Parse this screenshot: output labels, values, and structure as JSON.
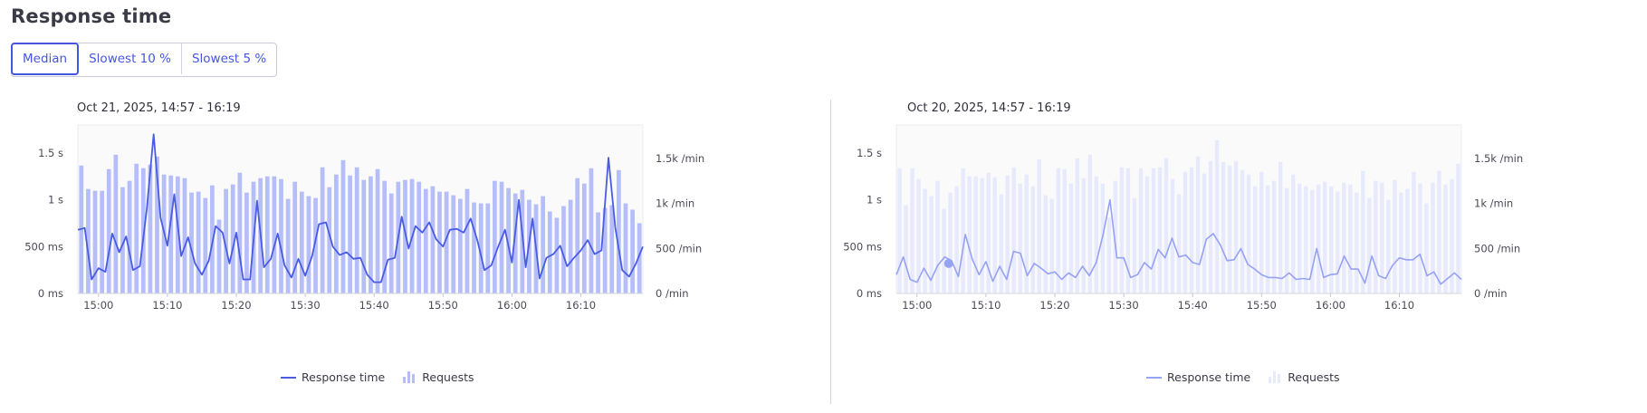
{
  "header": {
    "title": "Response time",
    "tabs": [
      {
        "label": "Median",
        "active": true
      },
      {
        "label": "Slowest 10 %",
        "active": false
      },
      {
        "label": "Slowest 5 %",
        "active": false
      }
    ]
  },
  "colors": {
    "accent": "#4556e0",
    "left_line": "#4a5ce2",
    "left_bars": "#b6befa",
    "right_line": "#96a2f4",
    "right_bars": "#e7e9fd",
    "plot_bg": "#fafafb"
  },
  "legend": {
    "line_label": "Response time",
    "bars_label": "Requests"
  },
  "chart_data": [
    {
      "type": "bar+line",
      "title": "Oct 21, 2025, 14:57 - 16:19",
      "x_ticks": [
        "15:00",
        "15:10",
        "15:20",
        "15:30",
        "15:40",
        "15:50",
        "16:00",
        "16:10"
      ],
      "x_tick_minutes": [
        3,
        13,
        23,
        33,
        43,
        53,
        63,
        73
      ],
      "y_left_ticks": [
        "0 ms",
        "500 ms",
        "1 s",
        "1.5 s"
      ],
      "y_left_tick_values": [
        0,
        500,
        1000,
        1500
      ],
      "y_right_ticks": [
        "0 /min",
        "500 /min",
        "1k /min",
        "1.5k /min"
      ],
      "y_right_tick_values": [
        0,
        500,
        1000,
        1500
      ],
      "y_left_range_ms": [
        0,
        1800
      ],
      "y_right_range_per_min": [
        0,
        1870
      ],
      "highlight_marker": null,
      "series": [
        {
          "name": "Requests",
          "kind": "bar",
          "unit": "/min",
          "values": [
            1420,
            1160,
            1140,
            1140,
            1380,
            1540,
            1180,
            1250,
            1440,
            1390,
            1430,
            1520,
            1320,
            1310,
            1300,
            1280,
            1120,
            1130,
            1060,
            1200,
            820,
            1160,
            1210,
            1340,
            1120,
            1240,
            1280,
            1300,
            1300,
            1270,
            1050,
            1240,
            1130,
            1080,
            1060,
            1400,
            1180,
            1320,
            1480,
            1310,
            1400,
            1260,
            1300,
            1380,
            1250,
            1110,
            1240,
            1260,
            1270,
            1240,
            1160,
            1190,
            1130,
            1130,
            1090,
            1050,
            1160,
            1010,
            1000,
            1000,
            1250,
            1240,
            1170,
            1110,
            1150,
            1040,
            990,
            1080,
            910,
            840,
            970,
            1040,
            1280,
            1220,
            1390,
            900,
            950,
            980,
            1370,
            1000,
            930,
            780
          ]
        },
        {
          "name": "Response time",
          "kind": "line",
          "unit": "ms",
          "values": [
            680,
            700,
            150,
            270,
            230,
            640,
            440,
            610,
            250,
            290,
            900,
            1700,
            810,
            510,
            1060,
            400,
            600,
            320,
            200,
            350,
            720,
            650,
            320,
            650,
            150,
            150,
            990,
            280,
            370,
            640,
            300,
            170,
            370,
            190,
            400,
            740,
            760,
            500,
            410,
            440,
            370,
            380,
            200,
            120,
            120,
            360,
            380,
            820,
            480,
            720,
            650,
            760,
            580,
            500,
            680,
            690,
            650,
            800,
            560,
            250,
            300,
            500,
            680,
            330,
            1000,
            280,
            800,
            160,
            380,
            420,
            510,
            290,
            380,
            460,
            570,
            420,
            460,
            1450,
            700,
            250,
            180,
            320,
            500
          ]
        }
      ]
    },
    {
      "type": "bar+line",
      "title": "Oct 20, 2025, 14:57 - 16:19",
      "x_ticks": [
        "15:00",
        "15:10",
        "15:20",
        "15:30",
        "15:40",
        "15:50",
        "16:00",
        "16:10"
      ],
      "x_tick_minutes": [
        3,
        13,
        23,
        33,
        43,
        53,
        63,
        73
      ],
      "y_left_ticks": [
        "0 ms",
        "500 ms",
        "1 s",
        "1.5 s"
      ],
      "y_left_tick_values": [
        0,
        500,
        1000,
        1500
      ],
      "y_right_ticks": [
        "0 /min",
        "500 /min",
        "1k /min",
        "1.5k /min"
      ],
      "y_right_tick_values": [
        0,
        500,
        1000,
        1500
      ],
      "y_left_range_ms": [
        0,
        1800
      ],
      "y_right_range_per_min": [
        0,
        1870
      ],
      "highlight_marker": {
        "minute": 7.6,
        "value_ms": 320
      },
      "series": [
        {
          "name": "Requests",
          "kind": "bar",
          "unit": "/min",
          "values": [
            1390,
            980,
            1390,
            1270,
            1160,
            1080,
            1250,
            940,
            1120,
            1190,
            1390,
            1300,
            1300,
            1280,
            1340,
            1290,
            1100,
            1310,
            1400,
            1220,
            1320,
            1190,
            1490,
            1090,
            1050,
            1390,
            1380,
            1220,
            1500,
            1280,
            1540,
            1300,
            1220,
            840,
            1250,
            1400,
            1390,
            1060,
            1390,
            1300,
            1390,
            1400,
            1500,
            1270,
            1100,
            1350,
            1400,
            1520,
            1330,
            1470,
            1700,
            1460,
            1420,
            1470,
            1370,
            1320,
            1190,
            1350,
            1200,
            1250,
            1460,
            1170,
            1320,
            1220,
            1190,
            1150,
            1210,
            1240,
            1190,
            1130,
            1230,
            1210,
            1120,
            1360,
            1060,
            1250,
            1230,
            1040,
            1260,
            1120,
            1160,
            1350,
            1220,
            1000,
            1230,
            1360,
            1210,
            1270,
            1440
          ]
        },
        {
          "name": "Response time",
          "kind": "line",
          "unit": "ms",
          "values": [
            200,
            390,
            150,
            120,
            270,
            140,
            300,
            390,
            350,
            180,
            630,
            370,
            200,
            340,
            130,
            290,
            150,
            450,
            430,
            190,
            320,
            270,
            210,
            230,
            150,
            220,
            170,
            290,
            190,
            330,
            630,
            1000,
            380,
            380,
            170,
            200,
            330,
            260,
            470,
            380,
            590,
            390,
            410,
            330,
            310,
            580,
            640,
            520,
            350,
            360,
            480,
            310,
            260,
            200,
            170,
            170,
            160,
            220,
            150,
            160,
            150,
            480,
            170,
            200,
            210,
            400,
            260,
            260,
            110,
            400,
            190,
            160,
            300,
            380,
            360,
            360,
            420,
            190,
            230,
            100,
            160,
            220,
            150
          ]
        }
      ]
    }
  ]
}
